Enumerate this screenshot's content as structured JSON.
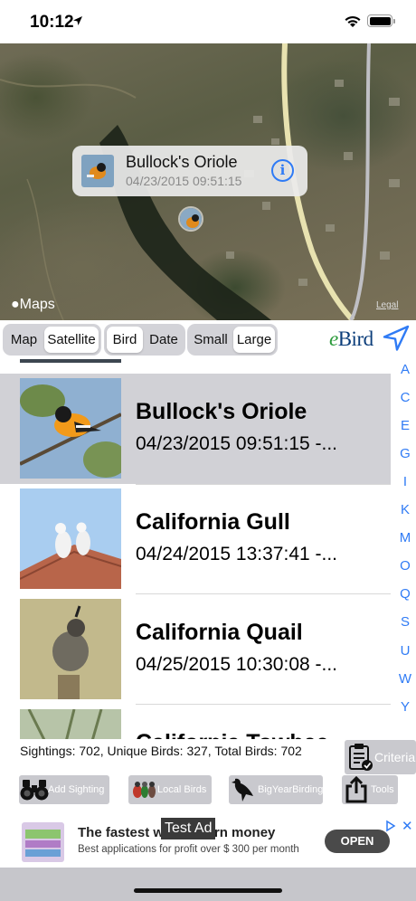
{
  "status_bar": {
    "time": "10:12"
  },
  "map": {
    "attribution": "Maps",
    "legal": "Legal",
    "callout": {
      "title": "Bullock's Oriole",
      "subtitle": "04/23/2015 09:51:15"
    }
  },
  "toolbar": {
    "map_type": [
      "Map",
      "Satellite"
    ],
    "sort": [
      "Bird",
      "Date"
    ],
    "size": [
      "Small",
      "Large"
    ],
    "brand": {
      "e": "e",
      "bird": "Bird"
    }
  },
  "sightings": [
    {
      "name": "Bullock's Oriole",
      "datetime": "04/23/2015 09:51:15 -...",
      "selected": true
    },
    {
      "name": "California Gull",
      "datetime": "04/24/2015 13:37:41 -...",
      "selected": false
    },
    {
      "name": "California Quail",
      "datetime": "04/25/2015 10:30:08 -...",
      "selected": false
    },
    {
      "name": "California Towhee",
      "datetime": "",
      "selected": false
    }
  ],
  "index_letters": [
    "A",
    "C",
    "E",
    "G",
    "I",
    "K",
    "M",
    "O",
    "Q",
    "S",
    "U",
    "W",
    "Y"
  ],
  "summary": "Sightings: 702, Unique Birds: 327, Total Birds: 702",
  "buttons": {
    "criteria": "Criteria",
    "add_sighting": "Add Sighting",
    "local_birds": "Local Birds",
    "big_year": "BigYearBirding",
    "tools": "Tools"
  },
  "ad": {
    "badge": "Test Ad",
    "title": "The fastest way to earn money",
    "subtitle": "Best applications for profit over $ 300 per month",
    "cta": "OPEN"
  },
  "colors": {
    "accent": "#2f7bf5",
    "selected_row": "#d1d1d6",
    "button_gray": "#c9c9ce"
  }
}
